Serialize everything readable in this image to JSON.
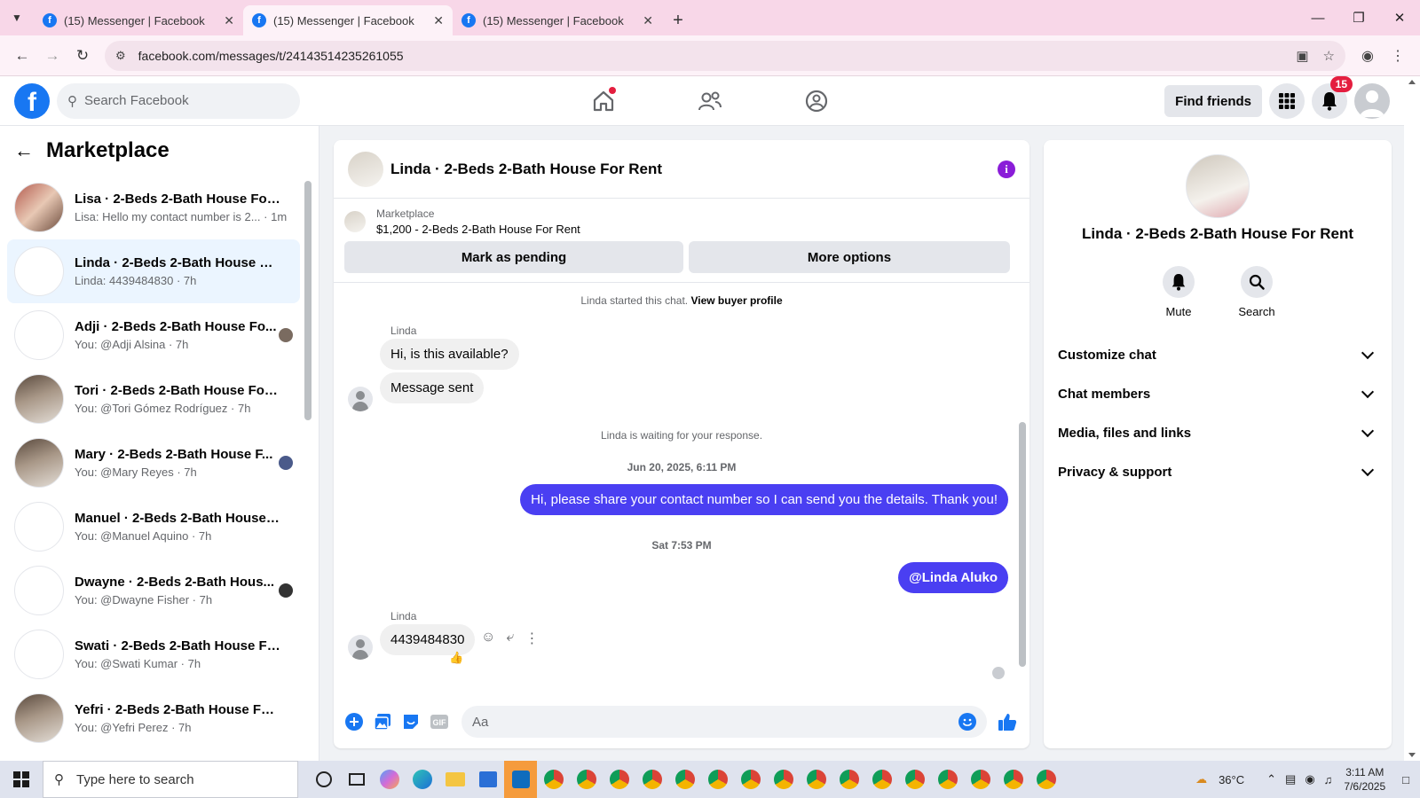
{
  "browser": {
    "tabs": [
      {
        "title": "(15) Messenger | Facebook",
        "active": false
      },
      {
        "title": "(15) Messenger | Facebook",
        "active": true
      },
      {
        "title": "(15) Messenger | Facebook",
        "active": false
      }
    ],
    "url": "facebook.com/messages/t/24143514235261055"
  },
  "header": {
    "search_placeholder": "Search Facebook",
    "find_friends": "Find friends",
    "notification_count": "15"
  },
  "left_panel": {
    "title": "Marketplace",
    "conversations": [
      {
        "name": "Lisa · 2-Beds 2-Bath House For R...",
        "preview": "Lisa: Hello my contact number is 2... · 1m",
        "avatar": "photo1"
      },
      {
        "name": "Linda · 2-Beds 2-Bath House For...",
        "preview": "Linda: 4439484830 · 7h",
        "avatar": "blank"
      },
      {
        "name": "Adji · 2-Beds 2-Bath House Fo...",
        "preview": "You: @Adji Alsina · 7h",
        "avatar": "blank"
      },
      {
        "name": "Tori · 2-Beds 2-Bath House For R...",
        "preview": "You: @Tori Gómez Rodríguez · 7h",
        "avatar": "photo2"
      },
      {
        "name": "Mary · 2-Beds 2-Bath House F...",
        "preview": "You: @Mary Reyes · 7h",
        "avatar": "photo2"
      },
      {
        "name": "Manuel · 2-Beds 2-Bath House F...",
        "preview": "You: @Manuel Aquino · 7h",
        "avatar": "blank"
      },
      {
        "name": "Dwayne · 2-Beds 2-Bath Hous...",
        "preview": "You: @Dwayne Fisher · 7h",
        "avatar": "blank"
      },
      {
        "name": "Swati · 2-Beds 2-Bath House For...",
        "preview": "You: @Swati Kumar · 7h",
        "avatar": "blank"
      },
      {
        "name": "Yefri · 2-Beds 2-Bath House For ...",
        "preview": "You: @Yefri Perez · 7h",
        "avatar": "photo2"
      }
    ]
  },
  "chat": {
    "title": "Linda · 2-Beds 2-Bath House For Rent",
    "marketplace_label": "Marketplace",
    "listing": "$1,200 - 2-Beds 2-Bath House For Rent",
    "mark_pending": "Mark as pending",
    "more_options": "More options",
    "started_text": "Linda started this chat.",
    "buyer_profile": "View buyer profile",
    "sender_name": "Linda",
    "msg1": "Hi, is this available?",
    "msg2": "Message sent",
    "waiting": "Linda is waiting for your response.",
    "date1": "Jun 20, 2025, 6:11 PM",
    "out1": "Hi, please share your contact number so I can send you the details. Thank you!",
    "date2": "Sat 7:53 PM",
    "out2": "@Linda Aluko",
    "msg3": "4439484830",
    "reaction": "👍",
    "composer_placeholder": "Aa"
  },
  "right_panel": {
    "name": "Linda · 2-Beds 2-Bath House For Rent",
    "mute": "Mute",
    "search": "Search",
    "sections": [
      "Customize chat",
      "Chat members",
      "Media, files and links",
      "Privacy & support"
    ]
  },
  "taskbar": {
    "search_placeholder": "Type here to search",
    "temperature": "36°C",
    "time": "3:11 AM",
    "date": "7/6/2025"
  },
  "colors": {
    "fb_blue": "#1877f2",
    "outgoing_bubble": "#4a3ff2",
    "tab_bar": "#f8d7e8",
    "badge_red": "#e41e3f"
  }
}
